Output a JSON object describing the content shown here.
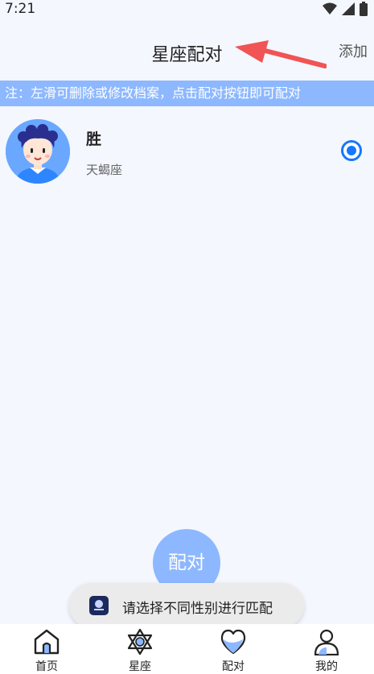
{
  "status": {
    "time": "7:21"
  },
  "header": {
    "title": "星座配对",
    "add_label": "添加"
  },
  "notice": "注：左滑可删除或修改档案，点击配对按钮即可配对",
  "profile": {
    "name": "胜",
    "sign": "天蝎座",
    "selected": true
  },
  "match_button": "配对",
  "toast": "请选择不同性别进行匹配",
  "tabs": [
    {
      "label": "首页",
      "icon": "home-icon"
    },
    {
      "label": "星座",
      "icon": "star-of-david-icon"
    },
    {
      "label": "配对",
      "icon": "heart-icon"
    },
    {
      "label": "我的",
      "icon": "person-icon"
    }
  ],
  "colors": {
    "accent": "#1677ff",
    "notice_bg": "#8db8ff",
    "background": "#f4f7fe",
    "annotation_arrow": "#f05454"
  }
}
